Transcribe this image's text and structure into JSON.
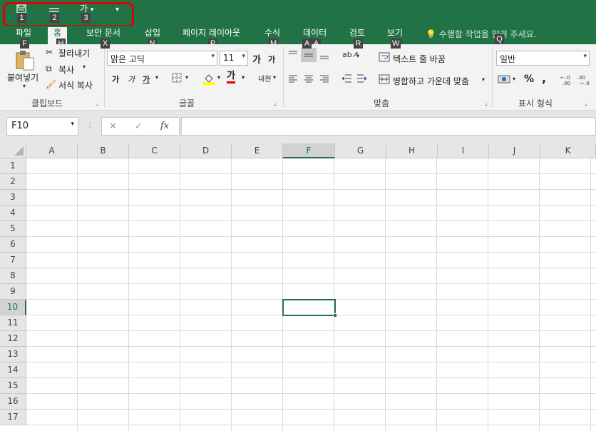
{
  "qat": {
    "icons": [
      "save-icon",
      "form-icon",
      "font-size-icon",
      "customize-qat-icon"
    ],
    "font_glyph": "가",
    "dropdown": "▾",
    "more": "▾",
    "keytips": [
      "1",
      "2",
      "3"
    ]
  },
  "tabs": [
    {
      "label": "파일",
      "keytip": "F"
    },
    {
      "label": "홈",
      "keytip": "H"
    },
    {
      "label": "보안 문서",
      "keytip": "X"
    },
    {
      "label": "삽입",
      "keytip": "N"
    },
    {
      "label": "페이지 레이아웃",
      "keytip": "P"
    },
    {
      "label": "수식",
      "keytip": "M"
    },
    {
      "label": "데이터",
      "keytip": "A"
    },
    {
      "label": "검토",
      "keytip": "R"
    },
    {
      "label": "보기",
      "keytip": "W"
    }
  ],
  "tell_me": "수행할 작업을 알려 주세요.",
  "tell_me_keytip": "Q",
  "clipboard": {
    "paste": "붙여넣기",
    "cut": "잘라내기",
    "copy": "복사",
    "format_painter": "서식 복사",
    "group": "클립보드"
  },
  "font": {
    "name": "맑은 고딕",
    "size": "11",
    "grow": "가",
    "shrink": "가",
    "bold": "가",
    "italic": "가",
    "underline": "가",
    "color_glyph": "가",
    "phonetic": "내천",
    "group": "글꼴"
  },
  "alignment": {
    "wrap_text": "텍스트 줄 바꿈",
    "merge_center": "병합하고 가운데 맞춤",
    "group": "맞춤"
  },
  "number": {
    "format": "일반",
    "percent": "%",
    "comma": ",",
    "inc_dec": "←.0 .00",
    "dec_dec": ".00 →.0",
    "group": "표시 형식"
  },
  "formula_bar": {
    "name_box": "F10",
    "cancel": "✕",
    "enter": "✓",
    "fx": "fx",
    "formula": ""
  },
  "columns": [
    "A",
    "B",
    "C",
    "D",
    "E",
    "F",
    "G",
    "H",
    "I",
    "J",
    "K"
  ],
  "rows": [
    "1",
    "2",
    "3",
    "4",
    "5",
    "6",
    "7",
    "8",
    "9",
    "10",
    "11",
    "12",
    "13",
    "14",
    "15",
    "16",
    "17"
  ],
  "selected_column": "F",
  "selected_row": "10",
  "colors": {
    "accent": "#217346",
    "highlight": "#e00000",
    "fill_yellow": "#ffff00",
    "font_red": "#e00000"
  }
}
